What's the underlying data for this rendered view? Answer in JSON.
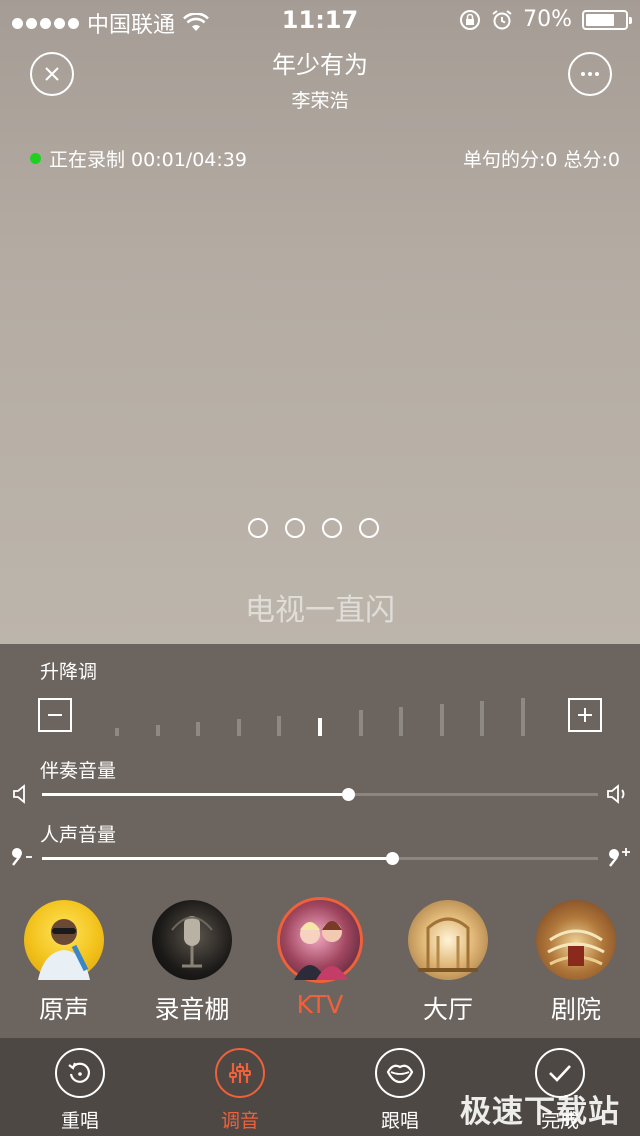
{
  "status_bar": {
    "carrier": "中国联通",
    "time": "11:17",
    "battery": "70%"
  },
  "header": {
    "song_title": "年少有为",
    "artist": "李荣浩"
  },
  "recording": {
    "status": "正在录制 00:01/04:39",
    "score": "单句的分:0 总分:0"
  },
  "lyric": "电视一直闪",
  "tuning": {
    "pitch_label": "升降调",
    "pitch_level": 5,
    "pitch_steps": 11,
    "accompaniment_label": "伴奏音量",
    "accompaniment_value": 0.55,
    "vocal_label": "人声音量",
    "vocal_value": 0.63
  },
  "effects": [
    {
      "name": "原声"
    },
    {
      "name": "录音棚"
    },
    {
      "name": "KTV"
    },
    {
      "name": "大厅"
    },
    {
      "name": "剧院"
    }
  ],
  "selected_effect": "KTV",
  "tabs": [
    {
      "label": "重唱"
    },
    {
      "label": "调音"
    },
    {
      "label": "跟唱"
    },
    {
      "label": "完成"
    }
  ],
  "selected_tab": "调音",
  "watermark": "极速下载站",
  "colors": {
    "accent": "#f0603a",
    "recording_dot": "#20d020",
    "panel": "#6c645e",
    "tabbar": "#4e4844"
  }
}
